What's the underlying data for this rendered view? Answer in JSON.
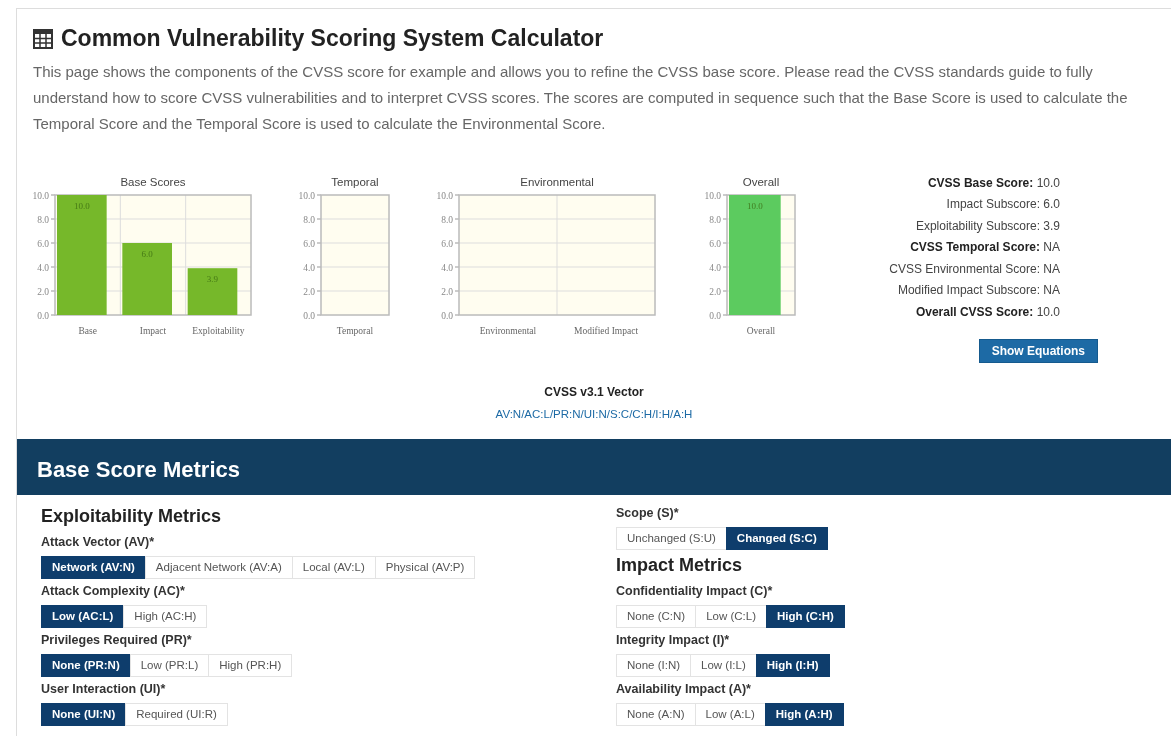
{
  "title": "Common Vulnerability Scoring System Calculator",
  "description": "This page shows the components of the CVSS score for example and allows you to refine the CVSS base score. Please read the CVSS standards guide to fully understand how to score CVSS vulnerabilities and to interpret CVSS scores. The scores are computed in sequence such that the Base Score is used to calculate the Temporal Score and the Temporal Score is used to calculate the Environmental Score.",
  "charts": [
    {
      "chart_data": {
        "type": "bar",
        "title": "Base Scores",
        "categories": [
          "Base",
          "Impact",
          "Exploitability"
        ],
        "series": [
          {
            "color": "#76b82a",
            "values": [
              10.0,
              6.0,
              3.9
            ]
          }
        ],
        "ylim": [
          0,
          10
        ],
        "yticks": [
          {
            "value": 0,
            "label": "0.0"
          },
          {
            "value": 2,
            "label": "2.0"
          },
          {
            "value": 4,
            "label": "4.0"
          },
          {
            "value": 6,
            "label": "6.0"
          },
          {
            "value": 8,
            "label": "8.0"
          },
          {
            "value": 10,
            "label": "10.0"
          }
        ],
        "grid": true,
        "value_labels": [
          "10.0",
          "6.0",
          "3.9"
        ]
      }
    },
    {
      "chart_data": {
        "type": "bar",
        "title": "Temporal",
        "categories": [
          "Temporal"
        ],
        "series": [
          {
            "values": [
              null
            ]
          }
        ],
        "ylim": [
          0,
          10
        ],
        "yticks": [
          {
            "value": 0,
            "label": "0.0"
          },
          {
            "value": 2,
            "label": "2.0"
          },
          {
            "value": 4,
            "label": "4.0"
          },
          {
            "value": 6,
            "label": "6.0"
          },
          {
            "value": 8,
            "label": "8.0"
          },
          {
            "value": 10,
            "label": "10.0"
          }
        ],
        "grid": true
      }
    },
    {
      "chart_data": {
        "type": "bar",
        "title": "Environmental",
        "categories": [
          "Environmental",
          "Modified Impact"
        ],
        "series": [
          {
            "values": [
              null,
              null
            ]
          }
        ],
        "ylim": [
          0,
          10
        ],
        "yticks": [
          {
            "value": 0,
            "label": "0.0"
          },
          {
            "value": 2,
            "label": "2.0"
          },
          {
            "value": 4,
            "label": "4.0"
          },
          {
            "value": 6,
            "label": "6.0"
          },
          {
            "value": 8,
            "label": "8.0"
          },
          {
            "value": 10,
            "label": "10.0"
          }
        ],
        "grid": true
      }
    },
    {
      "chart_data": {
        "type": "bar",
        "title": "Overall",
        "categories": [
          "Overall"
        ],
        "series": [
          {
            "color": "#5ccb5f",
            "values": [
              10.0
            ]
          }
        ],
        "ylim": [
          0,
          10
        ],
        "yticks": [
          {
            "value": 0,
            "label": "0.0"
          },
          {
            "value": 2,
            "label": "2.0"
          },
          {
            "value": 4,
            "label": "4.0"
          },
          {
            "value": 6,
            "label": "6.0"
          },
          {
            "value": 8,
            "label": "8.0"
          },
          {
            "value": 10,
            "label": "10.0"
          }
        ],
        "grid": true,
        "value_labels": [
          "10.0"
        ]
      }
    }
  ],
  "scores": [
    {
      "label": "CVSS Base Score:",
      "value": "10.0",
      "emphasis": true
    },
    {
      "label": "Impact Subscore:",
      "value": "6.0",
      "emphasis": false
    },
    {
      "label": "Exploitability Subscore:",
      "value": "3.9",
      "emphasis": false
    },
    {
      "label": "CVSS Temporal Score:",
      "value": "NA",
      "emphasis": true
    },
    {
      "label": "CVSS Environmental Score:",
      "value": "NA",
      "emphasis": false
    },
    {
      "label": "Modified Impact Subscore:",
      "value": "NA",
      "emphasis": false
    },
    {
      "label": "Overall CVSS Score:",
      "value": "10.0",
      "emphasis": true
    }
  ],
  "show_equations_button": "Show Equations",
  "vector": {
    "label": "CVSS v3.1 Vector",
    "value": "AV:N/AC:L/PR:N/UI:N/S:C/C:H/I:H/A:H"
  },
  "section_title": "Base Score Metrics",
  "columns": [
    {
      "items": [
        {
          "kind": "heading",
          "text": "Exploitability Metrics"
        },
        {
          "kind": "metric",
          "label": "Attack Vector (AV)*",
          "options": [
            {
              "label": "Network (AV:N)",
              "selected": true
            },
            {
              "label": "Adjacent Network (AV:A)",
              "selected": false
            },
            {
              "label": "Local (AV:L)",
              "selected": false
            },
            {
              "label": "Physical (AV:P)",
              "selected": false
            }
          ]
        },
        {
          "kind": "metric",
          "label": "Attack Complexity (AC)*",
          "options": [
            {
              "label": "Low (AC:L)",
              "selected": true
            },
            {
              "label": "High (AC:H)",
              "selected": false
            }
          ]
        },
        {
          "kind": "metric",
          "label": "Privileges Required (PR)*",
          "options": [
            {
              "label": "None (PR:N)",
              "selected": true
            },
            {
              "label": "Low (PR:L)",
              "selected": false
            },
            {
              "label": "High (PR:H)",
              "selected": false
            }
          ]
        },
        {
          "kind": "metric",
          "label": "User Interaction (UI)*",
          "options": [
            {
              "label": "None (UI:N)",
              "selected": true
            },
            {
              "label": "Required (UI:R)",
              "selected": false
            }
          ]
        }
      ]
    },
    {
      "items": [
        {
          "kind": "metric",
          "label": "Scope (S)*",
          "options": [
            {
              "label": "Unchanged (S:U)",
              "selected": false
            },
            {
              "label": "Changed (S:C)",
              "selected": true
            }
          ]
        },
        {
          "kind": "heading",
          "text": "Impact Metrics"
        },
        {
          "kind": "metric",
          "label": "Confidentiality Impact (C)*",
          "options": [
            {
              "label": "None (C:N)",
              "selected": false
            },
            {
              "label": "Low (C:L)",
              "selected": false
            },
            {
              "label": "High (C:H)",
              "selected": true
            }
          ]
        },
        {
          "kind": "metric",
          "label": "Integrity Impact (I)*",
          "options": [
            {
              "label": "None (I:N)",
              "selected": false
            },
            {
              "label": "Low (I:L)",
              "selected": false
            },
            {
              "label": "High (I:H)",
              "selected": true
            }
          ]
        },
        {
          "kind": "metric",
          "label": "Availability Impact (A)*",
          "options": [
            {
              "label": "None (A:N)",
              "selected": false
            },
            {
              "label": "Low (A:L)",
              "selected": false
            },
            {
              "label": "High (A:H)",
              "selected": true
            }
          ]
        }
      ]
    }
  ]
}
